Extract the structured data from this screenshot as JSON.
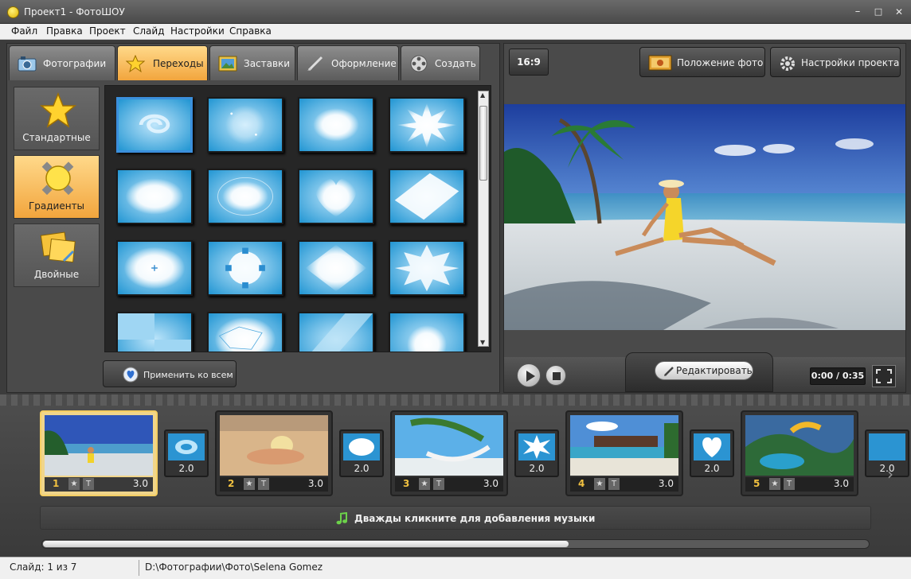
{
  "window": {
    "title": "Проект1 - ФотоШОУ",
    "controls": {
      "minimize": "–",
      "maximize": "□",
      "close": "✕"
    }
  },
  "menu": [
    "Файл",
    "Правка",
    "Проект",
    "Слайд",
    "Настройки",
    "Справка"
  ],
  "tabs": [
    {
      "label": "Фотографии",
      "icon": "camera-icon",
      "active": false
    },
    {
      "label": "Переходы",
      "icon": "star-icon",
      "active": true
    },
    {
      "label": "Заставки",
      "icon": "picture-icon",
      "active": false
    },
    {
      "label": "Оформление",
      "icon": "brush-icon",
      "active": false
    },
    {
      "label": "Создать",
      "icon": "film-reel-icon",
      "active": false
    }
  ],
  "categories": [
    {
      "label": "Стандартные",
      "icon": "star-icon",
      "active": false
    },
    {
      "label": "Градиенты",
      "icon": "gradient-icon",
      "active": true
    },
    {
      "label": "Двойные",
      "icon": "double-icon",
      "active": false
    }
  ],
  "transitions_grid": {
    "rows": 4,
    "cols": 4,
    "selected_index": 0,
    "shapes": [
      "swirl",
      "sparkle",
      "cloud",
      "burst",
      "oval",
      "oval-ring",
      "heart",
      "diamond",
      "circle-cross",
      "gear",
      "diamond-soft",
      "star-blob",
      "checker",
      "globe",
      "diagonal",
      "flower"
    ]
  },
  "apply_button": {
    "label": "Применить ко всем",
    "icon": "heart-shield-icon"
  },
  "preview": {
    "aspect": "16:9",
    "photo_position_label": "Положение фото",
    "project_settings_label": "Настройки проекта",
    "edit_label": "Редактировать",
    "time": "0:00 / 0:35"
  },
  "slides": [
    {
      "num": "1",
      "duration": "3.0",
      "scene": "beach",
      "selected": true
    },
    {
      "num": "2",
      "duration": "3.0",
      "scene": "sand",
      "selected": false
    },
    {
      "num": "3",
      "duration": "3.0",
      "scene": "hammock",
      "selected": false
    },
    {
      "num": "4",
      "duration": "3.0",
      "scene": "resort",
      "selected": false
    },
    {
      "num": "5",
      "duration": "3.0",
      "scene": "paraglide",
      "selected": false
    }
  ],
  "transitions": [
    {
      "duration": "2.0"
    },
    {
      "duration": "2.0"
    },
    {
      "duration": "2.0"
    },
    {
      "duration": "2.0"
    },
    {
      "duration": "2.0"
    }
  ],
  "music_hint": "Дважды кликните для добавления музыки",
  "status": {
    "slide": "Слайд: 1 из 7",
    "path": "D:\\Фотографии\\Фото\\Selena Gomez"
  },
  "colors": {
    "accent_orange": "#f2a53d",
    "selection_blue": "#3b8fdc",
    "panel_dark": "#4a4a4a"
  }
}
